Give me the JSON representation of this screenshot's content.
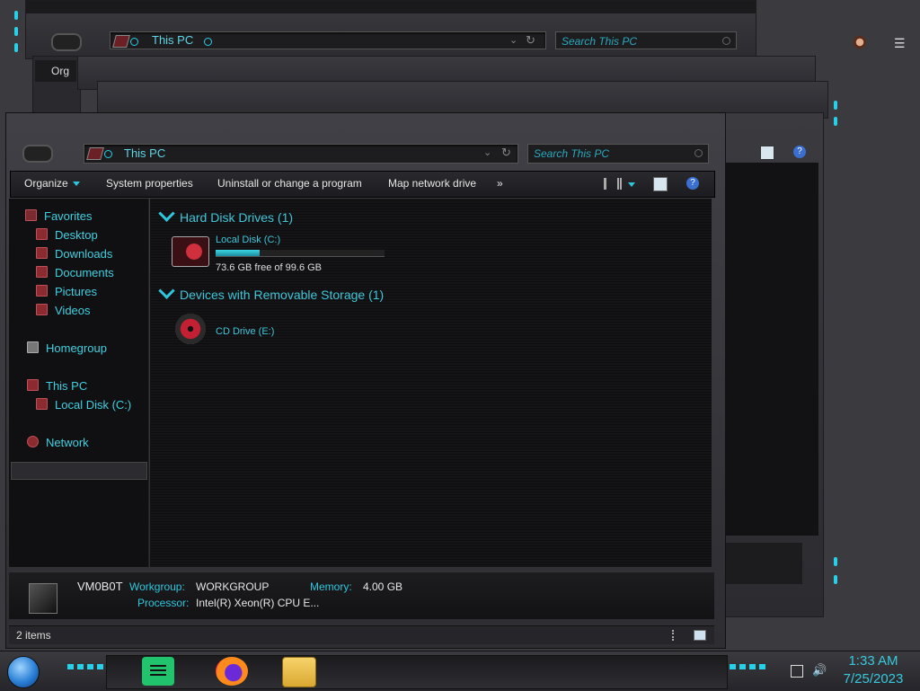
{
  "background_windows": {
    "top": {
      "address_text": "This PC",
      "search_placeholder": "Search This PC",
      "partial_toolbar_text": "Org"
    }
  },
  "main_window": {
    "address": {
      "text": "This PC"
    },
    "search": {
      "placeholder": "Search This PC"
    },
    "toolbar": {
      "organize": "Organize",
      "system_properties": "System properties",
      "uninstall": "Uninstall or change a program",
      "map_drive": "Map network drive",
      "more": "»"
    },
    "nav": {
      "favorites": "Favorites",
      "desktop": "Desktop",
      "downloads": "Downloads",
      "documents": "Documents",
      "pictures": "Pictures",
      "videos": "Videos",
      "homegroup": "Homegroup",
      "this_pc": "This PC",
      "local_disk": "Local Disk (C:)",
      "network": "Network"
    },
    "groups": {
      "hdd_title": "Hard Disk Drives (1)",
      "removable_title": "Devices with Removable Storage (1)"
    },
    "drives": {
      "local_label": "Local Disk (C:)",
      "local_free": "73.6 GB free of 99.6 GB",
      "local_used_fraction": 0.26,
      "cd_label": "CD Drive (E:)"
    },
    "details": {
      "computer_name": "VM0B0T",
      "workgroup_label": "Workgroup:",
      "workgroup_value": "WORKGROUP",
      "memory_label": "Memory:",
      "memory_value": "4.00 GB",
      "processor_label": "Processor:",
      "processor_value": "Intel(R) Xeon(R) CPU E..."
    },
    "status": {
      "items": "2 items"
    }
  },
  "taskbar": {
    "time": "1:33 AM",
    "date": "7/25/2023",
    "apps": [
      "notes-app-icon",
      "firefox-icon",
      "file-explorer-icon"
    ]
  },
  "colors": {
    "accent": "#26d0e8",
    "link": "#3fd0e0",
    "dark": "#101012"
  }
}
